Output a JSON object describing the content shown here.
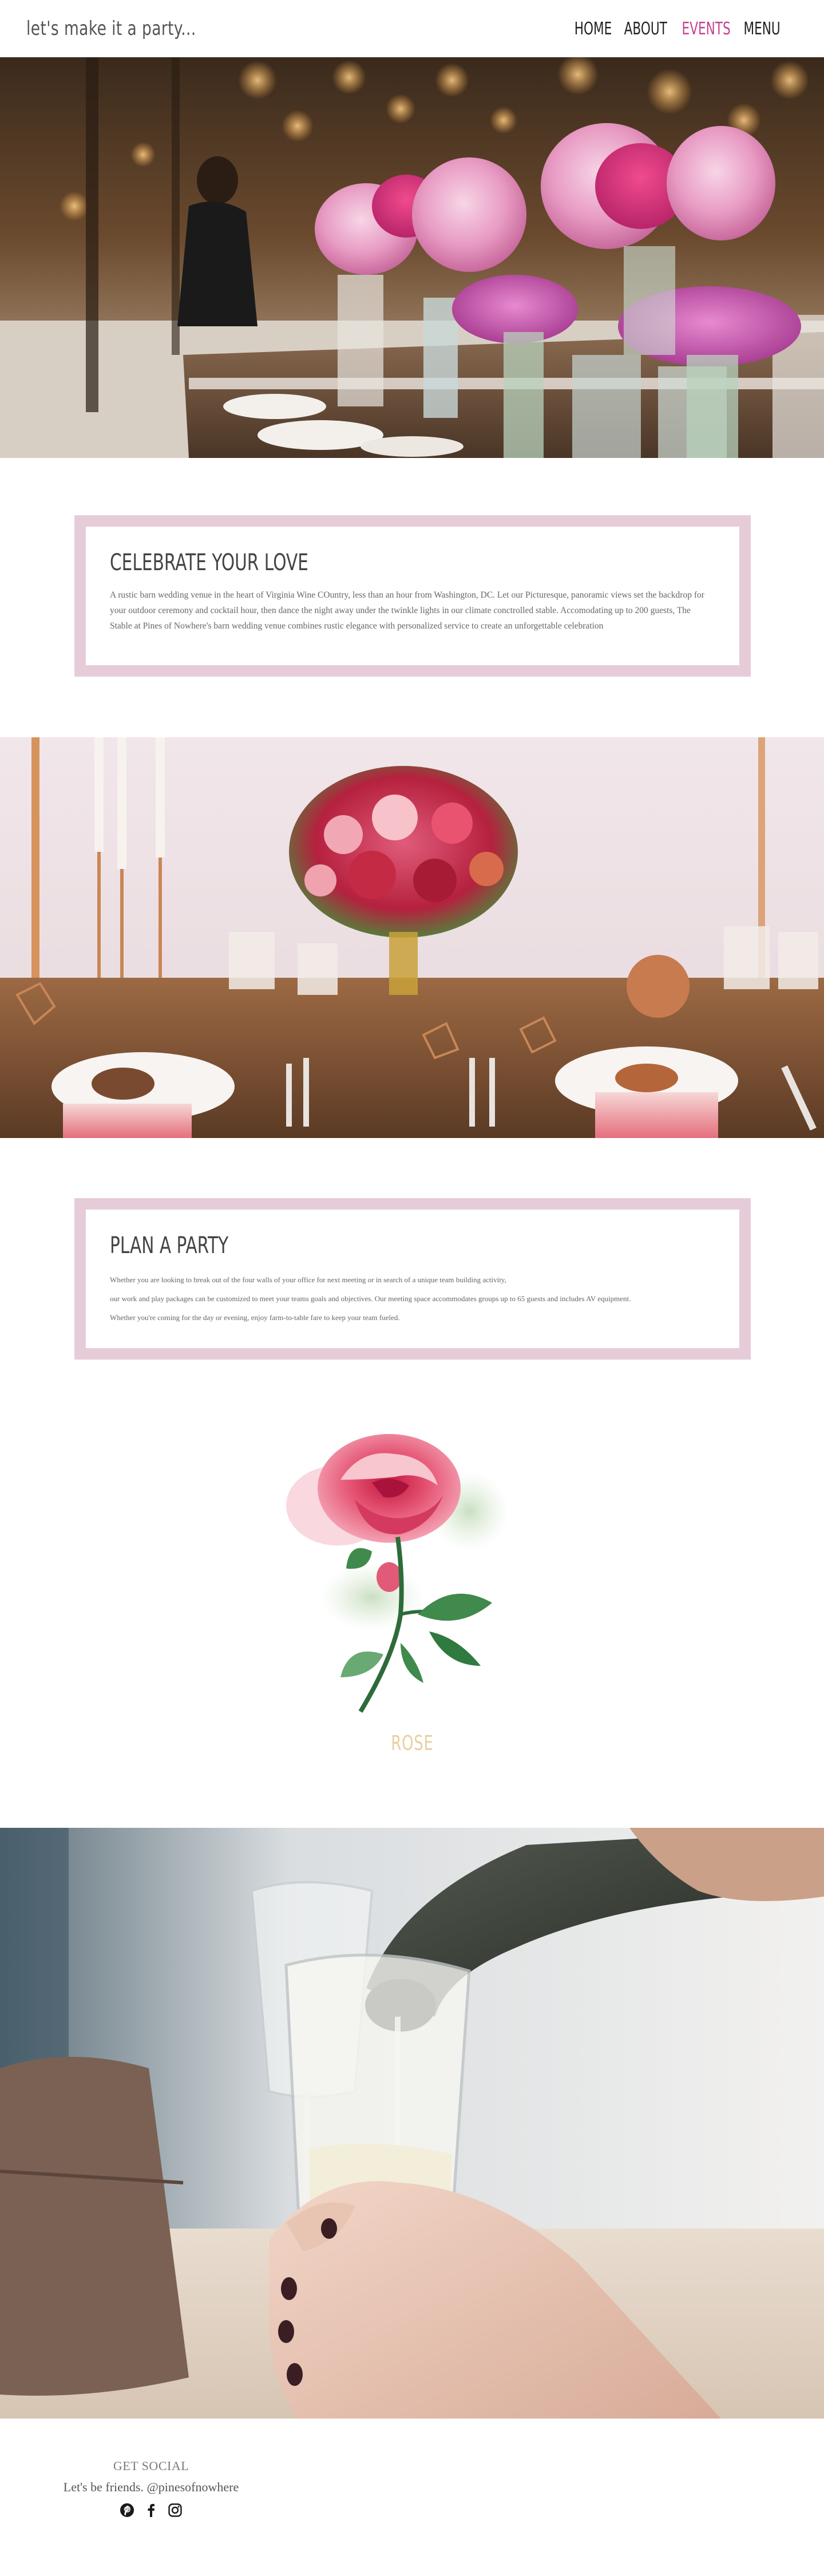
{
  "header": {
    "logo": "let's make it a party...",
    "nav": [
      {
        "label": "HOME"
      },
      {
        "label": "ABOUT"
      },
      {
        "label": "EVENTS",
        "active": true
      },
      {
        "label": "MENU"
      }
    ]
  },
  "celebrate": {
    "title": "CELEBRATE YOUR LOVE",
    "body": "A rustic barn wedding venue in the heart of Virginia Wine COuntry, less than an hour from Washington, DC. Let our Picturesque, panoramic views set the backdrop for your outdoor ceremony and cocktail hour, then dance the night away under the twinkle lights in our climate conctrolled stable. Accomodating up to 200 guests, The Stable at Pines of Nowhere's barn wedding venue combines rustic elegance with personalized service to create an unforgettable celebration"
  },
  "party": {
    "title": "PLAN A PARTY",
    "lines": [
      "Whether you are looking to break out of the four walls of your office for next meeting or in search of a unique team building activity,",
      " our work and play packages can be customized to meet your teams goals and objectives. Our meeting space accommodates groups up to 65 guests and includes AV equipment.",
      "Whether you're coming for the day or evening, enjoy farm-to-table fare to keep your team fueled."
    ]
  },
  "rose": {
    "caption": "ROSE"
  },
  "footer": {
    "social_title": "GET SOCIAL",
    "social_handle": "Let's be friends. @pinesofnowhere",
    "icons": [
      "pinterest-icon",
      "facebook-icon",
      "instagram-icon"
    ]
  },
  "colors": {
    "accent": "#c5428f",
    "frame": "#e6ccd9",
    "rose_caption": "#e8cfa0"
  }
}
